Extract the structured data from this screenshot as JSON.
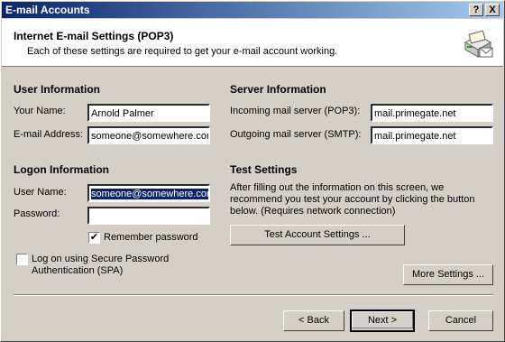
{
  "window": {
    "title": "E-mail Accounts",
    "help_glyph": "?",
    "close_glyph": "X"
  },
  "header": {
    "title": "Internet E-mail Settings (POP3)",
    "subtitle": "Each of these settings are required to get your e-mail account working.",
    "icon": "mail-server-icon"
  },
  "user_info": {
    "heading": "User Information",
    "name_label": "Your Name:",
    "name_value": "Arnold Palmer",
    "email_label": "E-mail Address:",
    "email_value": "someone@somewhere.com"
  },
  "server_info": {
    "heading": "Server Information",
    "incoming_label": "Incoming mail server (POP3):",
    "incoming_value": "mail.primegate.net",
    "outgoing_label": "Outgoing mail server (SMTP):",
    "outgoing_value": "mail.primegate.net"
  },
  "logon_info": {
    "heading": "Logon Information",
    "username_label": "User Name:",
    "username_value": "someone@somewhere.com",
    "password_label": "Password:",
    "password_value": "",
    "remember_label": "Remember password",
    "remember_checked": true,
    "spa_label_line1": "Log on using Secure Password",
    "spa_label_line2": "Authentication (SPA)",
    "spa_checked": false
  },
  "test_settings": {
    "heading": "Test Settings",
    "description_line1": "After filling out the information on this screen, we",
    "description_line2": "recommend you test your account by clicking the button",
    "description_line3": "below. (Requires network connection)",
    "button_label": "Test Account Settings ..."
  },
  "buttons": {
    "more_settings": "More Settings ...",
    "back": "< Back",
    "next": "Next >",
    "cancel": "Cancel"
  }
}
